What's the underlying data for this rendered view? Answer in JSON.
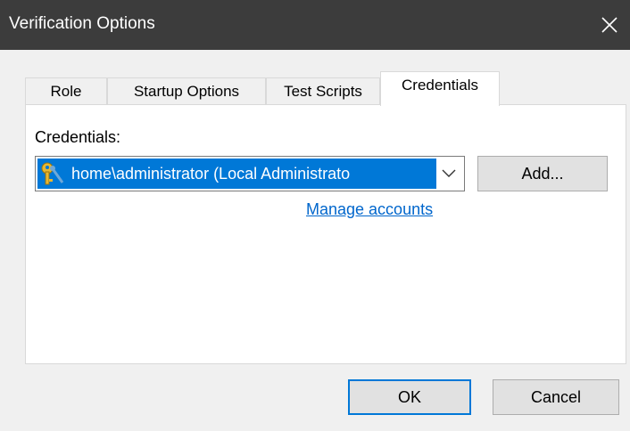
{
  "window": {
    "title": "Verification Options"
  },
  "tabs": [
    {
      "label": "Role",
      "active": false
    },
    {
      "label": "Startup Options",
      "active": false
    },
    {
      "label": "Test Scripts",
      "active": false
    },
    {
      "label": "Credentials",
      "active": true
    }
  ],
  "credentials": {
    "label": "Credentials:",
    "selected_value": "home\\administrator (Local Administrato",
    "add_label": "Add...",
    "manage_link": "Manage accounts"
  },
  "footer": {
    "ok_label": "OK",
    "cancel_label": "Cancel"
  },
  "colors": {
    "titlebar": "#3c3c3c",
    "selection": "#0078d7",
    "link": "#0066cc"
  },
  "icons": {
    "close": "close-icon",
    "key": "key-icon",
    "dropdown": "chevron-down-icon"
  }
}
